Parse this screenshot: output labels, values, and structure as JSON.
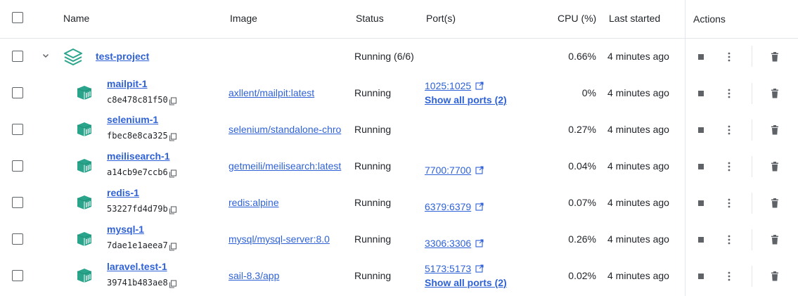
{
  "header": {
    "name": "Name",
    "image": "Image",
    "status": "Status",
    "ports": "Port(s)",
    "cpu": "CPU (%)",
    "last_started": "Last started",
    "actions": "Actions"
  },
  "group": {
    "name": "test-project",
    "status": "Running (6/6)",
    "cpu": "0.66%",
    "last_started": "4 minutes ago",
    "icon": "stack-layers-icon",
    "expanded": true
  },
  "containers": [
    {
      "name": "mailpit-1",
      "id": "c8e478c81f50",
      "image": "axllent/mailpit:latest",
      "status": "Running",
      "port": "1025:1025",
      "show_all": "Show all ports (2)",
      "cpu": "0%",
      "last_started": "4 minutes ago"
    },
    {
      "name": "selenium-1",
      "id": "fbec8e8ca325",
      "image": "selenium/standalone-chro",
      "status": "Running",
      "port": "",
      "show_all": "",
      "cpu": "0.27%",
      "last_started": "4 minutes ago"
    },
    {
      "name": "meilisearch-1",
      "id": "a14cb9e7ccb6",
      "image": "getmeili/meilisearch:latest",
      "status": "Running",
      "port": "7700:7700",
      "show_all": "",
      "cpu": "0.04%",
      "last_started": "4 minutes ago"
    },
    {
      "name": "redis-1",
      "id": "53227fd4d79b",
      "image": "redis:alpine",
      "status": "Running",
      "port": "6379:6379",
      "show_all": "",
      "cpu": "0.07%",
      "last_started": "4 minutes ago"
    },
    {
      "name": "mysql-1",
      "id": "7dae1e1aeea7",
      "image": "mysql/mysql-server:8.0",
      "status": "Running",
      "port": "3306:3306",
      "show_all": "",
      "cpu": "0.26%",
      "last_started": "4 minutes ago"
    },
    {
      "name": "laravel.test-1",
      "id": "39741b483ae8",
      "image": "sail-8.3/app",
      "status": "Running",
      "port": "5173:5173",
      "show_all": "Show all ports (2)",
      "cpu": "0.02%",
      "last_started": "4 minutes ago"
    }
  ],
  "colors": {
    "link": "#2f62d6",
    "container_icon": "#2aa58c",
    "icon_gray": "#5f6368"
  }
}
